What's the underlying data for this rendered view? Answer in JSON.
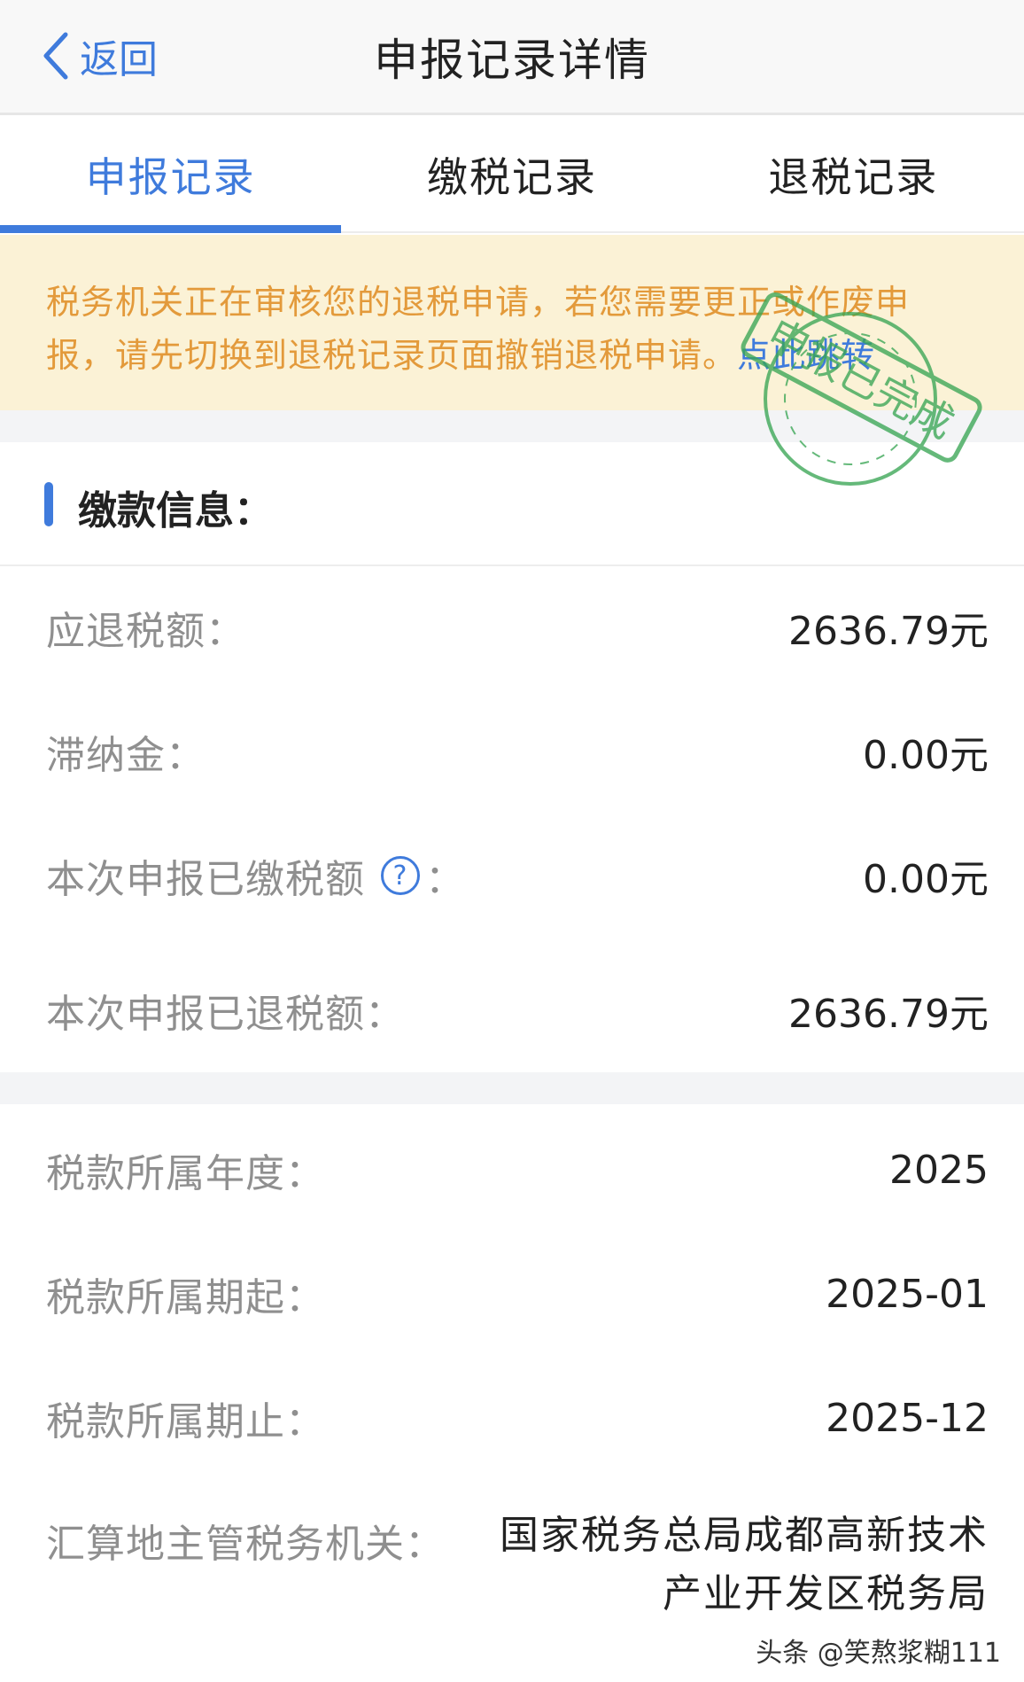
{
  "header": {
    "back_label": "返回",
    "title": "申报记录详情"
  },
  "tabs": [
    {
      "label": "申报记录",
      "active": true
    },
    {
      "label": "缴税记录",
      "active": false
    },
    {
      "label": "退税记录",
      "active": false
    }
  ],
  "notice": {
    "line1": "税务机关正在审核您的退税申请，若您需要更正或作废申",
    "line2": "报，请先切换到退税记录页面撤销退税申请。",
    "link": "点此跳转"
  },
  "stamp_text": "申报已完成",
  "section": {
    "title": "缴款信息："
  },
  "payment_rows": [
    {
      "label": "应退税额：",
      "value": "2636.79元"
    },
    {
      "label": "滞纳金：",
      "value": "0.00元"
    },
    {
      "label": "本次申报已缴税额",
      "label_suffix": "：",
      "value": "0.00元",
      "help_icon": "question-circle-icon"
    },
    {
      "label": "本次申报已退税额：",
      "value": "2636.79元"
    }
  ],
  "period_rows": [
    {
      "label": "税款所属年度：",
      "value": "2025"
    },
    {
      "label": "税款所属期起：",
      "value": "2025-01"
    },
    {
      "label": "税款所属期止：",
      "value": "2025-12"
    }
  ],
  "authority": {
    "label": "汇算地主管税务机关：",
    "value_line1": "国家税务总局成都高新技术",
    "value_line2": "产业开发区税务局"
  },
  "watermark": "头条 @笑熬浆糊111",
  "colors": {
    "accent": "#3f7bdc",
    "notice_bg": "#fbf2d6",
    "notice_text": "#e39a3b",
    "stamp": "#3aa655"
  }
}
